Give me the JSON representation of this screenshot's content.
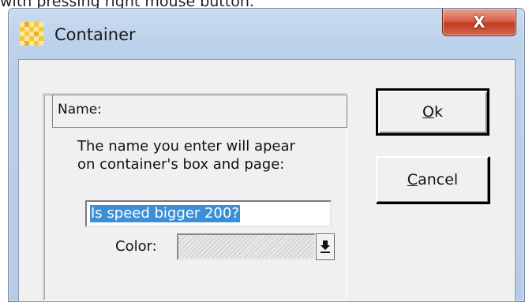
{
  "background": {
    "caption": "with pressing right mouse button."
  },
  "window": {
    "title": "Container",
    "close_symbol": "X",
    "icon": "app-checker-icon",
    "close_icon": "close-icon"
  },
  "form": {
    "name_label": "Name:",
    "description_line1": "The name you enter will apear",
    "description_line2": "on container's box and page:",
    "name_value": "Is speed bigger 200?",
    "color_label": "Color:",
    "color_dropdown_icon": "arrow-down-underline-icon"
  },
  "buttons": {
    "ok_accel": "O",
    "ok_rest": "k",
    "cancel_accel": "C",
    "cancel_rest": "ancel"
  },
  "colors": {
    "selection": "#3b8fd6",
    "close_button": "#c23a21",
    "title_gradient": "#c9dbef"
  }
}
